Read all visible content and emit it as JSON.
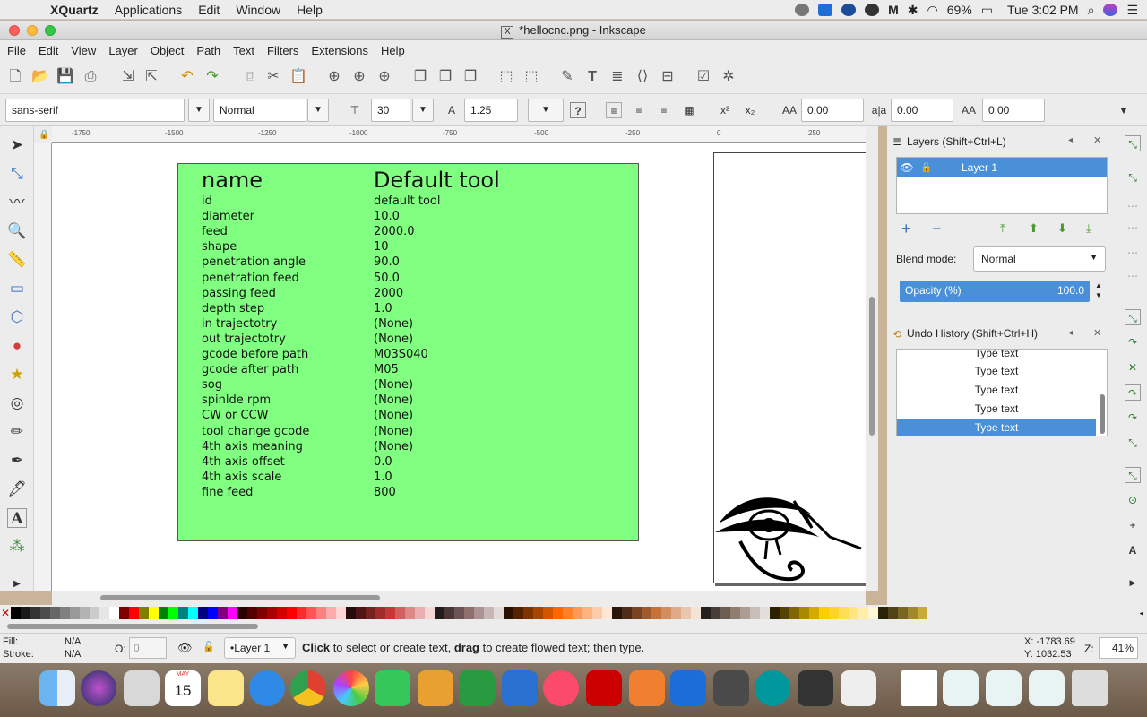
{
  "mac_menubar": {
    "app": "XQuartz",
    "items": [
      "Applications",
      "Edit",
      "Window",
      "Help"
    ],
    "battery": "69%",
    "clock": "Tue 3:02 PM"
  },
  "window": {
    "title": "*hellocnc.png - Inkscape"
  },
  "app_menu": [
    "File",
    "Edit",
    "View",
    "Layer",
    "Object",
    "Path",
    "Text",
    "Filters",
    "Extensions",
    "Help"
  ],
  "text_toolbar": {
    "font_family": "sans-serif",
    "font_style": "Normal",
    "font_size": "30",
    "line_spacing": "1.25",
    "letter_spacing": "0.00",
    "word_spacing": "0.00",
    "kerning": "0.00"
  },
  "ruler_labels": [
    "-1750",
    "-1500",
    "-1250",
    "-1000",
    "-750",
    "-500",
    "-250",
    "0",
    "250"
  ],
  "canvas_table": {
    "header_key": "name",
    "header_value": "Default tool",
    "rows": [
      [
        "id",
        "default tool"
      ],
      [
        "diameter",
        "10.0"
      ],
      [
        "feed",
        "2000.0"
      ],
      [
        "shape",
        "10"
      ],
      [
        "penetration angle",
        "90.0"
      ],
      [
        "penetration feed",
        "50.0"
      ],
      [
        "passing feed",
        "2000"
      ],
      [
        "depth step",
        "1.0"
      ],
      [
        "in trajectotry",
        "(None)"
      ],
      [
        "out trajectotry",
        "(None)"
      ],
      [
        "gcode before path",
        "M03S040"
      ],
      [
        "gcode after path",
        "M05"
      ],
      [
        "sog",
        "(None)"
      ],
      [
        "spinlde rpm",
        "(None)"
      ],
      [
        "CW or CCW",
        "(None)"
      ],
      [
        "tool change gcode",
        "(None)"
      ],
      [
        "4th axis meaning",
        "(None)"
      ],
      [
        "4th axis offset",
        "0.0"
      ],
      [
        "4th axis scale",
        "1.0"
      ],
      [
        "fine feed",
        "800"
      ]
    ]
  },
  "layers_panel": {
    "title": "Layers (Shift+Ctrl+L)",
    "layer_name": "Layer 1",
    "blend_label": "Blend mode:",
    "blend_value": "Normal",
    "opacity_label": "Opacity (%)",
    "opacity_value": "100.0"
  },
  "undo_panel": {
    "title": "Undo History (Shift+Ctrl+H)",
    "items": [
      "Type text",
      "Type text",
      "Type text",
      "Type text",
      "Type text"
    ]
  },
  "status": {
    "fill_label": "Fill:",
    "fill_value": "N/A",
    "stroke_label": "Stroke:",
    "stroke_value": "N/A",
    "opacity_label": "O:",
    "opacity_value": "0",
    "layer": "•Layer 1",
    "message_bold1": "Click",
    "message_mid": " to select or create text, ",
    "message_bold2": "drag",
    "message_end": " to create flowed text; then type.",
    "x_coord": "X: -1783.69",
    "y_coord": "Y: 1032.53",
    "zoom_label": "Z:",
    "zoom": "41%"
  },
  "dock_date": {
    "month": "MAY",
    "day": "15"
  },
  "colors": {
    "canvas_green": "#80ff80",
    "selection": "#4a90d9"
  }
}
